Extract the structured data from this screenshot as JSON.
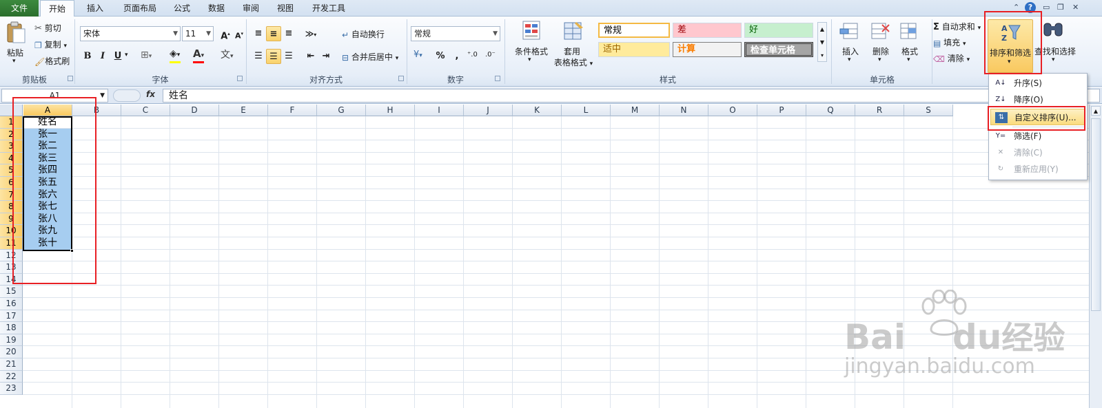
{
  "tabs": {
    "file": "文件",
    "items": [
      "开始",
      "插入",
      "页面布局",
      "公式",
      "数据",
      "审阅",
      "视图",
      "开发工具"
    ],
    "active_index": 0
  },
  "clipboard": {
    "paste": "粘贴",
    "cut": "剪切",
    "copy": "复制",
    "format_painter": "格式刷",
    "label": "剪贴板"
  },
  "font": {
    "name": "宋体",
    "size": "11",
    "bold": "B",
    "italic": "I",
    "underline": "U",
    "label": "字体"
  },
  "alignment": {
    "wrap": "自动换行",
    "merge": "合并后居中",
    "label": "对齐方式"
  },
  "number": {
    "format": "常规",
    "percent": "%",
    "comma": ",",
    "label": "数字"
  },
  "styles": {
    "conditional": "条件格式",
    "table_format_1": "套用",
    "table_format_2": "表格格式",
    "cells": [
      {
        "text": "常规",
        "bg": "#ffffff",
        "color": "#000000"
      },
      {
        "text": "差",
        "bg": "#ffc7ce",
        "color": "#9c0006"
      },
      {
        "text": "好",
        "bg": "#c6efce",
        "color": "#006100"
      },
      {
        "text": "适中",
        "bg": "#ffeb9c",
        "color": "#9c6500"
      },
      {
        "text": "计算",
        "bg": "#f2f2f2",
        "color": "#fa7d00"
      },
      {
        "text": "检查单元格",
        "bg": "#a5a5a5",
        "color": "#ffffff"
      }
    ],
    "label": "样式"
  },
  "cells_group": {
    "insert": "插入",
    "delete": "删除",
    "format": "格式",
    "label": "单元格"
  },
  "editing": {
    "autosum": "自动求和",
    "fill": "填充",
    "clear": "清除",
    "sort_filter": "排序和筛选",
    "find_select": "查找和选择"
  },
  "formula_bar": {
    "name_box": "A1",
    "fx": "fx",
    "content": "姓名"
  },
  "grid": {
    "columns": [
      "A",
      "B",
      "C",
      "D",
      "E",
      "F",
      "G",
      "H",
      "I",
      "J",
      "K",
      "L",
      "M",
      "N",
      "O",
      "P",
      "Q",
      "R",
      "S"
    ],
    "rows": [
      "1",
      "2",
      "3",
      "4",
      "5",
      "6",
      "7",
      "8",
      "9",
      "10",
      "11",
      "12",
      "13",
      "14",
      "15",
      "16",
      "17",
      "18",
      "19",
      "20",
      "21",
      "22",
      "23"
    ],
    "column_a": [
      "姓名",
      "张一",
      "张二",
      "张三",
      "张四",
      "张五",
      "张六",
      "张七",
      "张八",
      "张九",
      "张十"
    ]
  },
  "sort_menu": {
    "items": [
      {
        "label": "升序(S)",
        "icon": "AZ",
        "enabled": true
      },
      {
        "label": "降序(O)",
        "icon": "ZA",
        "enabled": true
      },
      {
        "label": "自定义排序(U)...",
        "icon": "sort",
        "enabled": true
      },
      {
        "label": "筛选(F)",
        "icon": "filter",
        "enabled": true
      },
      {
        "label": "清除(C)",
        "icon": "clear",
        "enabled": false
      },
      {
        "label": "重新应用(Y)",
        "icon": "reapply",
        "enabled": false
      }
    ]
  },
  "watermark": {
    "brand": "Bai",
    "brand2": "du",
    "cn": "经验",
    "url": "jingyan.baidu.com"
  },
  "colors": {
    "accent": "#2a6e2c",
    "annotation": "#e81f24",
    "selection": "#a6cdf0",
    "header_selected": "#f9c960"
  }
}
